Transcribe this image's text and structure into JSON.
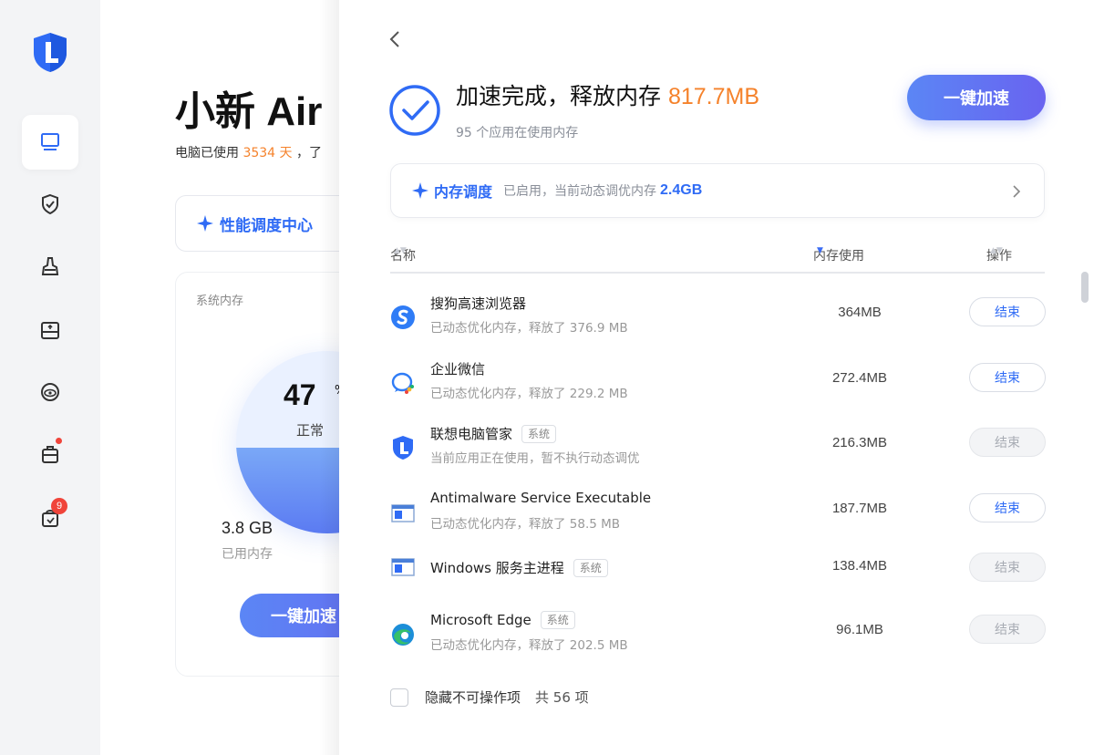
{
  "sidebar": {
    "items": [
      {
        "icon": "computer-icon"
      },
      {
        "icon": "shield-check-icon"
      },
      {
        "icon": "broom-icon"
      },
      {
        "icon": "drive-icon"
      },
      {
        "icon": "eye-care-icon"
      },
      {
        "icon": "toolbox-icon"
      },
      {
        "icon": "bag-icon",
        "badge": "9"
      }
    ]
  },
  "background": {
    "device_title": "小新 Air",
    "usage_prefix": "电脑已使用",
    "usage_days": "3534 天",
    "usage_suffix": "，了",
    "perf_center": "性能调度中心",
    "memory_card": {
      "title": "系统内存",
      "percent": "47",
      "percent_unit": "%",
      "percent_level": 0.47,
      "state": "正常",
      "used_value": "3.8 GB",
      "used_label": "已用内存",
      "boost_button": "一键加速"
    }
  },
  "panel": {
    "headline_prefix": "加速完成，释放内存",
    "headline_amount": "817.7MB",
    "subtitle": "95 个应用在使用内存",
    "boost_button": "一键加速",
    "schedule": {
      "title": "内存调度",
      "desc": "已启用，当前动态调优内存",
      "value": "2.4GB"
    },
    "table": {
      "col_name": "名称",
      "col_mem": "内存使用",
      "col_action": "操作",
      "rows": [
        {
          "name": "搜狗高速浏览器",
          "tag": "",
          "desc": "已动态优化内存，释放了 376.9 MB",
          "mem": "364MB",
          "action": "结束",
          "enabled": true,
          "icon": "sogou-browser-icon"
        },
        {
          "name": "企业微信",
          "tag": "",
          "desc": "已动态优化内存，释放了 229.2 MB",
          "mem": "272.4MB",
          "action": "结束",
          "enabled": true,
          "icon": "wecom-icon"
        },
        {
          "name": "联想电脑管家",
          "tag": "系统",
          "desc": "当前应用正在使用，暂不执行动态调优",
          "mem": "216.3MB",
          "action": "结束",
          "enabled": false,
          "icon": "lenovo-pc-manager-icon"
        },
        {
          "name": "Antimalware Service Executable",
          "tag": "",
          "desc": "已动态优化内存，释放了 58.5 MB",
          "mem": "187.7MB",
          "action": "结束",
          "enabled": true,
          "icon": "window-app-icon"
        },
        {
          "name": "Windows 服务主进程",
          "tag": "系统",
          "desc": "",
          "mem": "138.4MB",
          "action": "结束",
          "enabled": false,
          "icon": "window-app-icon"
        },
        {
          "name": "Microsoft Edge",
          "tag": "系统",
          "desc": "已动态优化内存，释放了 202.5 MB",
          "mem": "96.1MB",
          "action": "结束",
          "enabled": false,
          "icon": "edge-icon"
        }
      ]
    },
    "footer": {
      "hide_label": "隐藏不可操作项",
      "total": "共 56 项"
    }
  },
  "colors": {
    "accent": "#2f6bf5",
    "orange": "#f5822b"
  }
}
